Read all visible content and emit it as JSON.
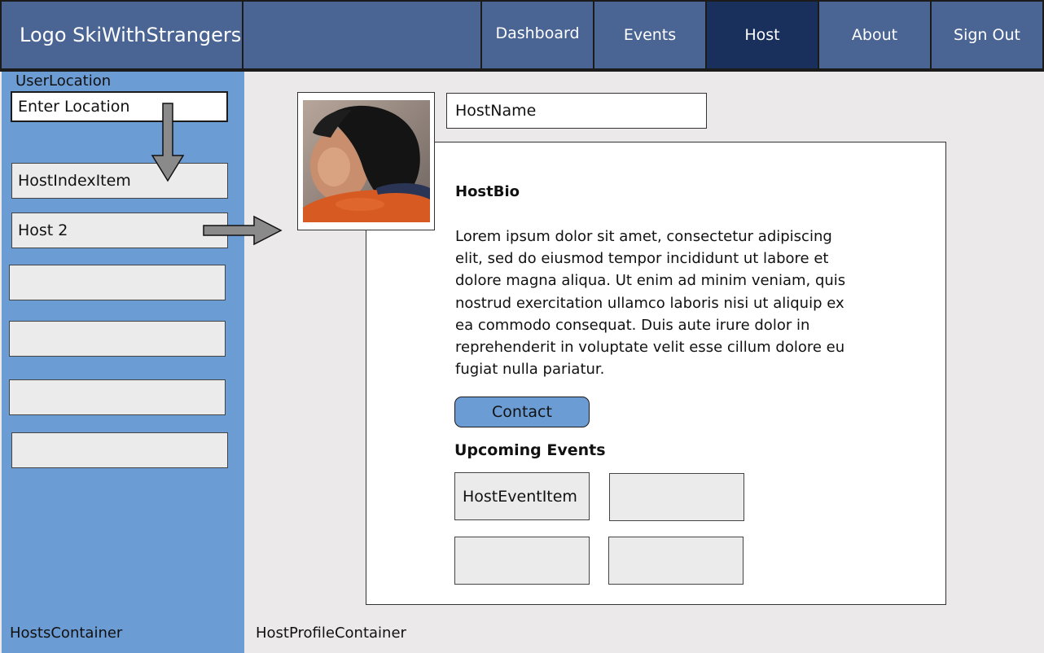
{
  "header": {
    "logo": "Logo SkiWithStrangers",
    "nav": [
      {
        "label": "Dashboard"
      },
      {
        "label": "Events"
      },
      {
        "label": "Host",
        "active": true
      },
      {
        "label": "About"
      },
      {
        "label": "Sign Out"
      }
    ]
  },
  "sidebar": {
    "location_label": "UserLocation",
    "location_input": {
      "placeholder": "Enter Location",
      "value": ""
    },
    "hosts": [
      {
        "label": "HostIndexItem"
      },
      {
        "label": "Host 2"
      },
      {
        "label": ""
      },
      {
        "label": ""
      },
      {
        "label": ""
      },
      {
        "label": ""
      }
    ],
    "container_label": "HostsContainer"
  },
  "profile": {
    "host_name": "HostName",
    "bio_title": "HostBio",
    "bio_text": "Lorem ipsum dolor sit amet, consectetur adipiscing elit, sed do eiusmod tempor incididunt ut labore et dolore magna aliqua. Ut enim ad minim veniam, quis nostrud exercitation ullamco laboris nisi ut aliquip ex ea commodo consequat. Duis aute irure dolor in reprehenderit in voluptate velit esse cillum dolore eu fugiat nulla pariatur.",
    "contact_label": "Contact",
    "events_title": "Upcoming Events",
    "events": [
      {
        "label": "HostEventItem"
      },
      {
        "label": ""
      },
      {
        "label": ""
      },
      {
        "label": ""
      }
    ],
    "container_label": "HostProfileContainer"
  },
  "colors": {
    "header_bg": "#4a6494",
    "header_active": "#1a305c",
    "sidebar_bg": "#6c9cd4",
    "content_bg": "#ebe9ea",
    "item_bg": "#ebebeb",
    "arrow": "#8a8a8a"
  }
}
